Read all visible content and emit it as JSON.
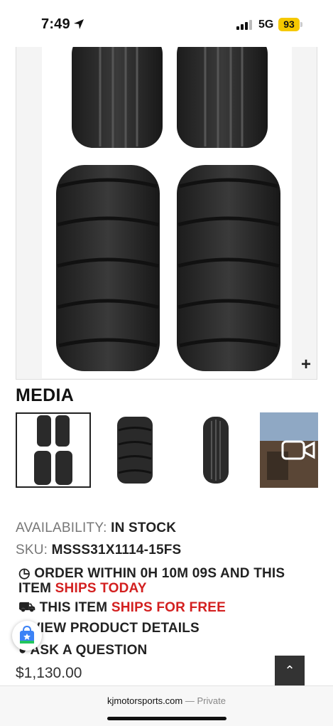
{
  "status_bar": {
    "time": "7:49",
    "network": "5G",
    "battery": "93"
  },
  "product": {
    "media_heading": "MEDIA",
    "availability_label": "AVAILABILITY:",
    "availability_value": "IN STOCK",
    "sku_label": "SKU:",
    "sku_value": "MSSS31X1114-15FS",
    "order_text": "ORDER WITHIN 0H 10M 09S AND THIS",
    "order_text_2": "ITEM",
    "ships_today": "SHIPS TODAY",
    "shipping_text": "THIS ITEM",
    "ships_free": "SHIPS FOR FREE",
    "view_details": "VIEW PRODUCT DETAILS",
    "ask_question": "ASK A QUESTION",
    "price": "$1,130.00"
  },
  "url_bar": {
    "domain": "kjmotorsports.com",
    "separator": " — ",
    "private": "Private"
  },
  "icons": {
    "zoom": "plus-icon",
    "clock": "clock-icon",
    "truck": "truck-icon",
    "video": "video-camera-icon",
    "scroll_top": "chevron-up-icon"
  },
  "colors": {
    "accent_red": "#d32020",
    "battery": "#f5c800"
  }
}
